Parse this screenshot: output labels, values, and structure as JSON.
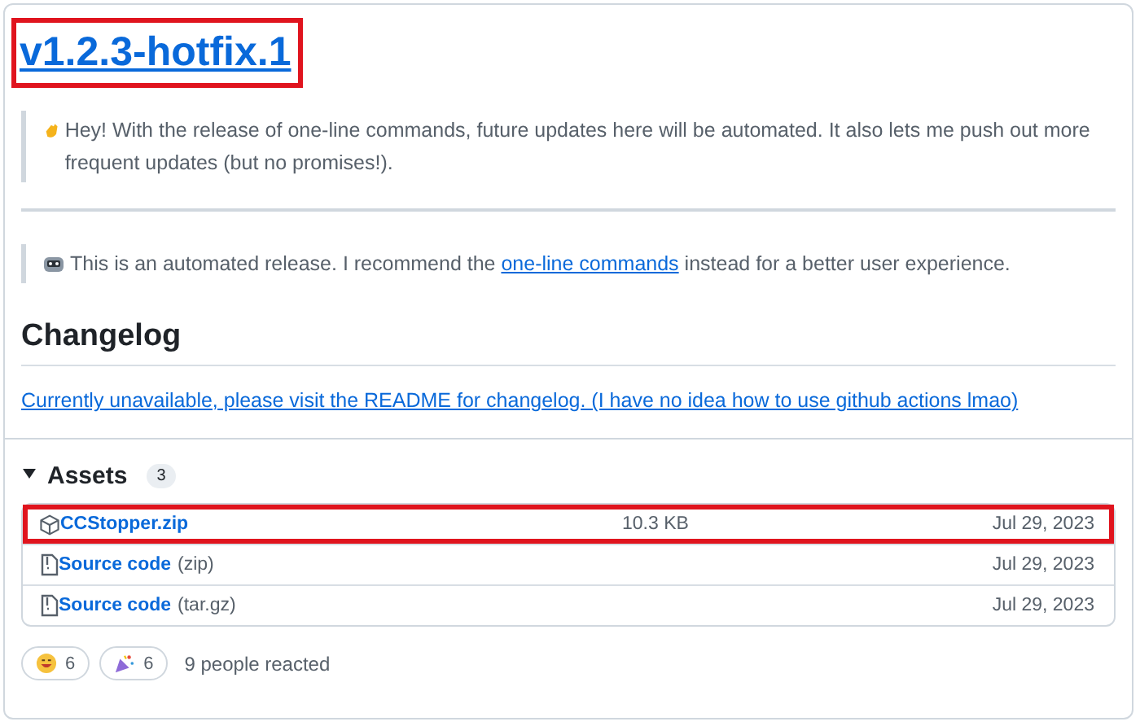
{
  "release": {
    "title": "v1.2.3-hotfix.1",
    "highlighted": true
  },
  "notes": [
    {
      "kind": "wave",
      "text": "Hey! With the release of one-line commands, future updates here will be automated. It also lets me push out more frequent updates (but no promises!)."
    },
    {
      "kind": "robot",
      "text": "This is an automated release. I recommend the ",
      "link": "one-line commands",
      "after": " instead for a better user experience."
    }
  ],
  "changelog": {
    "heading": "Changelog",
    "link": "Currently unavailable, please visit the README for changelog. (I have no idea how to use github actions lmao)"
  },
  "assets": {
    "label": "Assets",
    "count": "3",
    "expanded": true,
    "rows": [
      {
        "kind": "package",
        "name": "CCStopper.zip",
        "size": "10.3 KB",
        "date": "Jul 29, 2023",
        "highlighted": true
      },
      {
        "kind": "source",
        "name": "Source code",
        "suffix": "(zip)",
        "date": "Jul 29, 2023",
        "highlighted": false
      },
      {
        "kind": "source",
        "name": "Source code",
        "suffix": "(tar.gz)",
        "date": "Jul 29, 2023",
        "highlighted": false
      }
    ]
  },
  "reactions": [
    {
      "kind": "smile",
      "count": "6"
    },
    {
      "kind": "tada",
      "count": "6"
    }
  ],
  "reacted": "9 people reacted"
}
